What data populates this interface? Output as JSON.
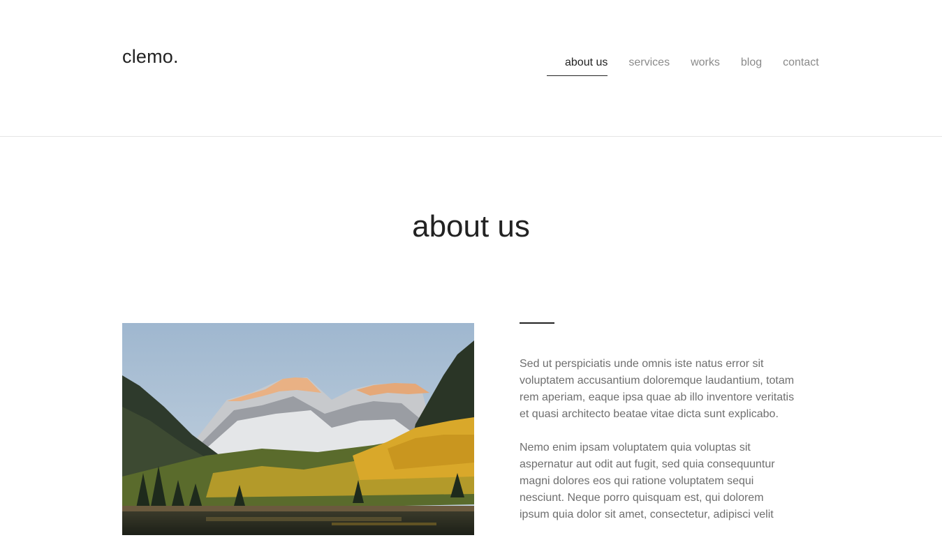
{
  "header": {
    "logo": "clemo.",
    "nav": [
      {
        "label": "about us",
        "active": true
      },
      {
        "label": "services",
        "active": false
      },
      {
        "label": "works",
        "active": false
      },
      {
        "label": "blog",
        "active": false
      },
      {
        "label": "contact",
        "active": false
      }
    ]
  },
  "main": {
    "title": "about us",
    "paragraphs": [
      "Sed ut perspiciatis unde omnis iste natus error sit voluptatem accusantium doloremque laudantium, totam rem aperiam, eaque ipsa quae ab illo inventore veritatis et quasi architecto beatae vitae dicta sunt explicabo.",
      "Nemo enim ipsam voluptatem quia voluptas sit aspernatur aut odit aut fugit, sed quia consequuntur magni dolores eos qui ratione voluptatem sequi nesciunt. Neque porro quisquam est, qui dolorem ipsum quia dolor sit amet, consectetur, adipisci velit"
    ]
  },
  "colors": {
    "text_dark": "#222222",
    "text_muted": "#6e6e6e",
    "nav_inactive": "#8a8a8a"
  }
}
